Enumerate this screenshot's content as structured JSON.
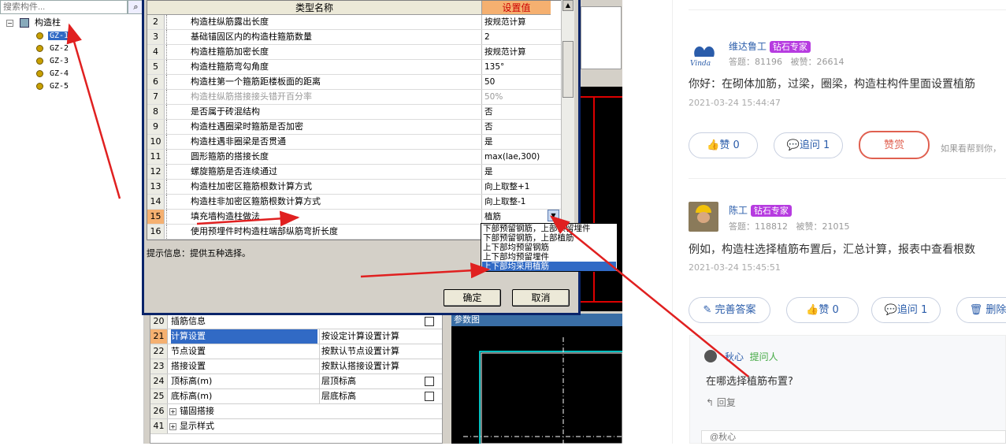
{
  "tree": {
    "search_placeholder": "搜索构件...",
    "search_icon": "search-icon",
    "root_label": "构造柱",
    "root_toggle": "−",
    "children": [
      "GZ-1",
      "GZ-2",
      "GZ-3",
      "GZ-4",
      "GZ-5"
    ]
  },
  "dialog": {
    "col_name": "类型名称",
    "col_value": "设置值",
    "rows": [
      {
        "n": "2",
        "k": "构造柱纵筋露出长度",
        "v": "按规范计算"
      },
      {
        "n": "3",
        "k": "基础锚固区内的构造柱箍筋数量",
        "v": "2"
      },
      {
        "n": "4",
        "k": "构造柱箍筋加密长度",
        "v": "按规范计算"
      },
      {
        "n": "5",
        "k": "构造柱箍筋弯勾角度",
        "v": "135°"
      },
      {
        "n": "6",
        "k": "构造柱第一个箍筋距楼板面的距离",
        "v": "50"
      },
      {
        "n": "7",
        "k": "构造柱纵筋搭接接头错开百分率",
        "v": "50%"
      },
      {
        "n": "8",
        "k": "是否属于砖混结构",
        "v": "否"
      },
      {
        "n": "9",
        "k": "构造柱遇圈梁时箍筋是否加密",
        "v": "否"
      },
      {
        "n": "10",
        "k": "构造柱遇非圈梁是否贯通",
        "v": "是"
      },
      {
        "n": "11",
        "k": "圆形箍筋的搭接长度",
        "v": "max(lae,300)"
      },
      {
        "n": "12",
        "k": "螺旋箍筋是否连续通过",
        "v": "是"
      },
      {
        "n": "13",
        "k": "构造柱加密区箍筋根数计算方式",
        "v": "向上取整+1"
      },
      {
        "n": "14",
        "k": "构造柱非加密区箍筋根数计算方式",
        "v": "向上取整-1"
      },
      {
        "n": "15",
        "k": "填充墙构造柱做法",
        "v": "植筋"
      },
      {
        "n": "16",
        "k": "使用预埋件时构造柱端部纵筋弯折长度",
        "v": ""
      }
    ],
    "dropdown_options": [
      "下部预留钢筋，上部预留埋件",
      "下部预留钢筋，上部植筋",
      "上下部均预留钢筋",
      "上下部均预留埋件",
      "上下部均采用植筋"
    ],
    "hint": "提示信息：提供五种选择。",
    "ok": "确定",
    "cancel": "取消"
  },
  "props": {
    "rows": [
      {
        "n": "20",
        "k": "插筋信息",
        "v": "",
        "check": true
      },
      {
        "n": "21",
        "k": "计算设置",
        "v": "按设定计算设置计算",
        "check": false
      },
      {
        "n": "22",
        "k": "节点设置",
        "v": "按默认节点设置计算",
        "check": false
      },
      {
        "n": "23",
        "k": "搭接设置",
        "v": "按默认搭接设置计算",
        "check": false
      },
      {
        "n": "24",
        "k": "顶标高(m)",
        "v": "层顶标高",
        "check": true
      },
      {
        "n": "25",
        "k": "底标高(m)",
        "v": "层底标高",
        "check": true
      },
      {
        "n": "26",
        "k": "锚固搭接",
        "v": "",
        "check": false
      },
      {
        "n": "41",
        "k": "显示样式",
        "v": "",
        "check": false
      }
    ],
    "cad_title": "参数图"
  },
  "qa": {
    "a1": {
      "name": "维达鲁工",
      "badge": "钻石专家",
      "answers_label": "答题：",
      "answers": "81196",
      "likes_label": "被赞：",
      "likes": "26614",
      "text": "你好：在砌体加筋，过梁，圈梁，构造柱构件里面设置植筋",
      "time": "2021-03-24 15:44:47",
      "like_btn": "赞 0",
      "ask_btn": "追问 1",
      "reward_btn": "赞赏",
      "tip": "如果看帮到你，"
    },
    "a2": {
      "name": "陈工",
      "badge": "钻石专家",
      "answers_label": "答题：",
      "answers": "118812",
      "likes_label": "被赞：",
      "likes": "21015",
      "text": "例如，构造柱选择植筋布置后，汇总计算，报表中查看根数",
      "time": "2021-03-24 15:45:51",
      "improve_btn": "完善答案",
      "like_btn": "赞 0",
      "ask_btn": "追问 1",
      "delete_btn": "删除"
    },
    "reply": {
      "user": "秋心",
      "role": "提问人",
      "text": "在哪选择植筋布置?",
      "reply_btn": "回复",
      "input_placeholder": "@秋心"
    }
  },
  "colors": {
    "annotation": "#e02020",
    "badge": "#b63be0",
    "link": "#2a5caa"
  }
}
